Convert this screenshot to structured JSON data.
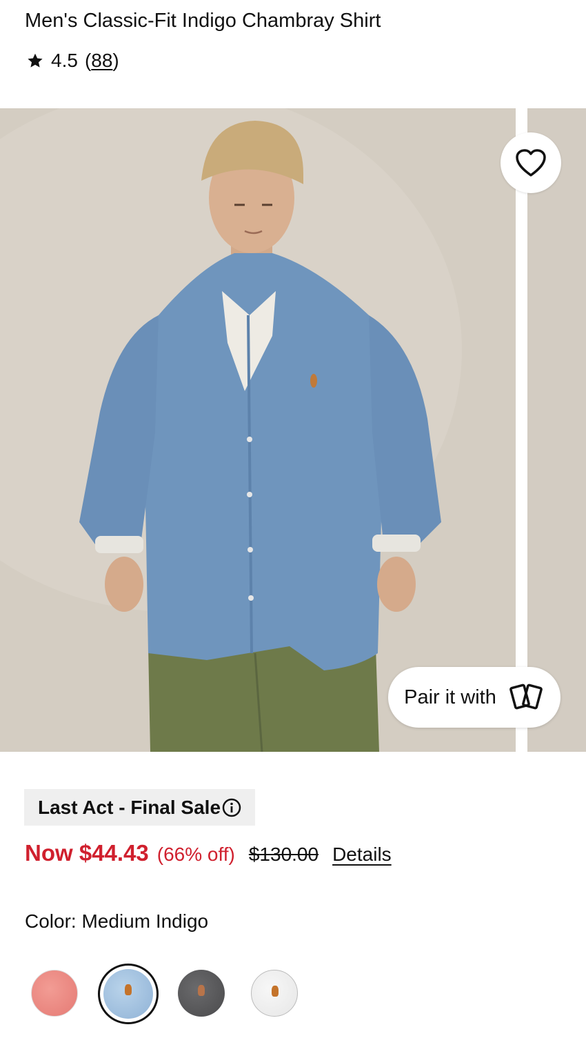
{
  "product": {
    "title": "Men's Classic-Fit Indigo Chambray Shirt",
    "rating_value": "4.5",
    "review_count": "88"
  },
  "gallery": {
    "pair_label": "Pair it with",
    "wishlist_icon": "heart-icon",
    "pair_icon": "cards-icon"
  },
  "sale": {
    "badge": "Last Act - Final Sale",
    "badge_icon": "info-icon"
  },
  "pricing": {
    "now": "Now $44.43",
    "discount": "(66% off)",
    "original": "$130.00",
    "details_link": "Details",
    "sale_color": "#d0202e"
  },
  "color": {
    "label": "Color: Medium Indigo",
    "swatches": [
      {
        "name": "coral",
        "color": "#e8847c",
        "selected": false
      },
      {
        "name": "medium-indigo",
        "color": "#a3c2e0",
        "selected": true
      },
      {
        "name": "charcoal",
        "color": "#58585a",
        "selected": false
      },
      {
        "name": "white",
        "color": "#f0f0f0",
        "selected": false
      }
    ]
  }
}
